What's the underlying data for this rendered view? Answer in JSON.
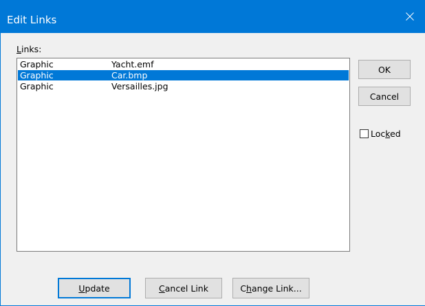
{
  "window": {
    "title": "Edit Links"
  },
  "links_label": {
    "accel": "L",
    "rest": "inks:"
  },
  "links": [
    {
      "type": "Graphic",
      "file": "Yacht.emf",
      "selected": false
    },
    {
      "type": "Graphic",
      "file": "Car.bmp",
      "selected": true
    },
    {
      "type": "Graphic",
      "file": "Versailles.jpg",
      "selected": false
    }
  ],
  "buttons": {
    "ok": "OK",
    "cancel": "Cancel",
    "update": {
      "accel": "U",
      "rest": "pdate"
    },
    "cancel_link": {
      "accel": "C",
      "rest": "ancel Link"
    },
    "change_link": {
      "pre": "C",
      "accel": "h",
      "rest": "ange Link..."
    }
  },
  "locked": {
    "pre": "Loc",
    "accel": "k",
    "rest": "ed",
    "checked": false
  },
  "colors": {
    "accent": "#0078d7",
    "background": "#f0f0f0"
  }
}
